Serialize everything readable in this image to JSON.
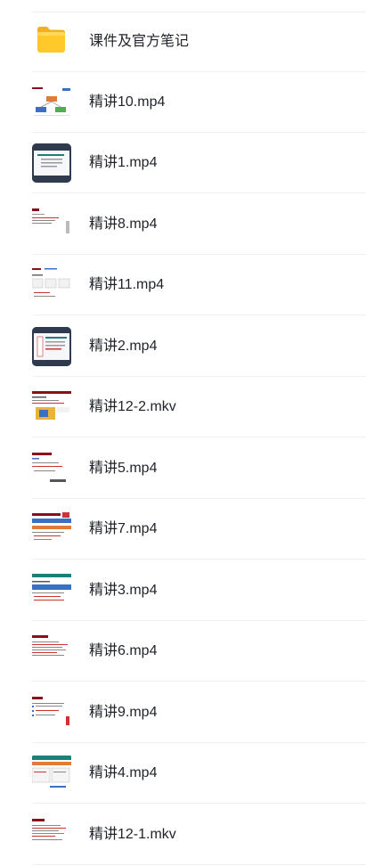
{
  "files": [
    {
      "name": "课件及官方笔记",
      "thumb": "folder-icon",
      "kind": "folder"
    },
    {
      "name": "精讲10.mp4",
      "thumb": "video-thumbnail",
      "kind": "flow"
    },
    {
      "name": "精讲1.mp4",
      "thumb": "video-thumbnail",
      "kind": "dark"
    },
    {
      "name": "精讲8.mp4",
      "thumb": "video-thumbnail",
      "kind": "slide"
    },
    {
      "name": "精讲11.mp4",
      "thumb": "video-thumbnail",
      "kind": "slide2"
    },
    {
      "name": "精讲2.mp4",
      "thumb": "video-thumbnail",
      "kind": "dark2"
    },
    {
      "name": "精讲12-2.mkv",
      "thumb": "video-thumbnail",
      "kind": "colorful"
    },
    {
      "name": "精讲5.mp4",
      "thumb": "video-thumbnail",
      "kind": "slide"
    },
    {
      "name": "精讲7.mp4",
      "thumb": "video-thumbnail",
      "kind": "bluebar"
    },
    {
      "name": "精讲3.mp4",
      "thumb": "video-thumbnail",
      "kind": "teal"
    },
    {
      "name": "精讲6.mp4",
      "thumb": "video-thumbnail",
      "kind": "text"
    },
    {
      "name": "精讲9.mp4",
      "thumb": "video-thumbnail",
      "kind": "slide2"
    },
    {
      "name": "精讲4.mp4",
      "thumb": "video-thumbnail",
      "kind": "teal2"
    },
    {
      "name": "精讲12-1.mkv",
      "thumb": "video-thumbnail",
      "kind": "text"
    }
  ],
  "colors": {
    "folder": "#f7c325",
    "folder_light": "#ffd95a",
    "slide_red": "#8b0f1a",
    "dark_thumb": "#2f3a4f",
    "teal": "#1b7f7a",
    "blue": "#3a6fc4"
  }
}
